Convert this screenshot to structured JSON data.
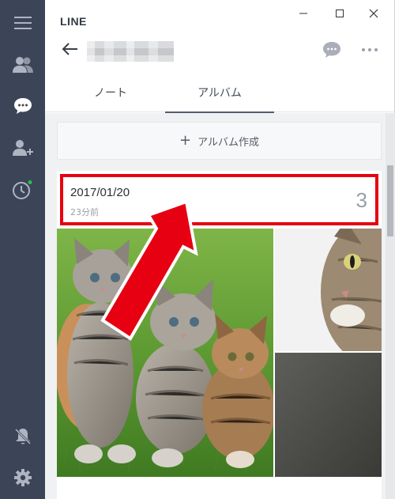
{
  "app": {
    "title": "LINE"
  },
  "window": {
    "minimize": "minimize-icon",
    "maximize": "maximize-icon",
    "close": "close-icon"
  },
  "sidebar": {
    "items": [
      {
        "icon": "menu-icon"
      },
      {
        "icon": "friends-icon"
      },
      {
        "icon": "chat-icon",
        "active": true
      },
      {
        "icon": "add-friend-icon"
      },
      {
        "icon": "timeline-icon",
        "badge_color": "#27c24c"
      }
    ],
    "bottom": [
      {
        "icon": "mute-bell-icon"
      },
      {
        "icon": "settings-icon"
      }
    ]
  },
  "header": {
    "back": "back-arrow-icon",
    "chat_name": "",
    "chat_icon": "chat-bubble-icon",
    "more_icon": "more-icon"
  },
  "tabs": [
    {
      "label": "ノート",
      "active": false
    },
    {
      "label": "アルバム",
      "active": true
    }
  ],
  "create_album": {
    "plus": "+",
    "label": "アルバム作成"
  },
  "album": {
    "date": "2017/01/20",
    "time_ago": "23分前",
    "count": "3",
    "photos": [
      "kittens-photo",
      "tabby-cat-photo",
      "gray-photo"
    ]
  },
  "colors": {
    "sidebar": "#3c4558",
    "highlight": "#e60012",
    "background": "#f0f1f3"
  }
}
